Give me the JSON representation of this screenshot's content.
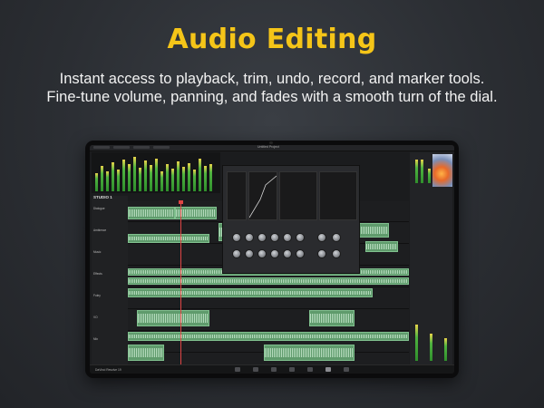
{
  "header": {
    "title": "Audio Editing",
    "subtitle_line1": "Instant access to playback, trim, undo, record, and marker tools.",
    "subtitle_line2": "Fine-tune volume, panning, and fades with a smooth turn of the dial."
  },
  "app": {
    "project_name": "Untitled Project",
    "brand_label": "STUDIO 1",
    "footer_brand": "DaVinci Resolve 19",
    "track_labels": [
      "Dialogue",
      "Ambience",
      "Music",
      "Effects",
      "Foley",
      "VO",
      "Mix"
    ]
  },
  "colors": {
    "title_accent": "#f5c518",
    "clip_green": "#5f9b6c",
    "playhead_red": "#e04545"
  },
  "icons": [
    "dial-icon",
    "meter-icon",
    "playhead-icon",
    "clip-icon"
  ]
}
